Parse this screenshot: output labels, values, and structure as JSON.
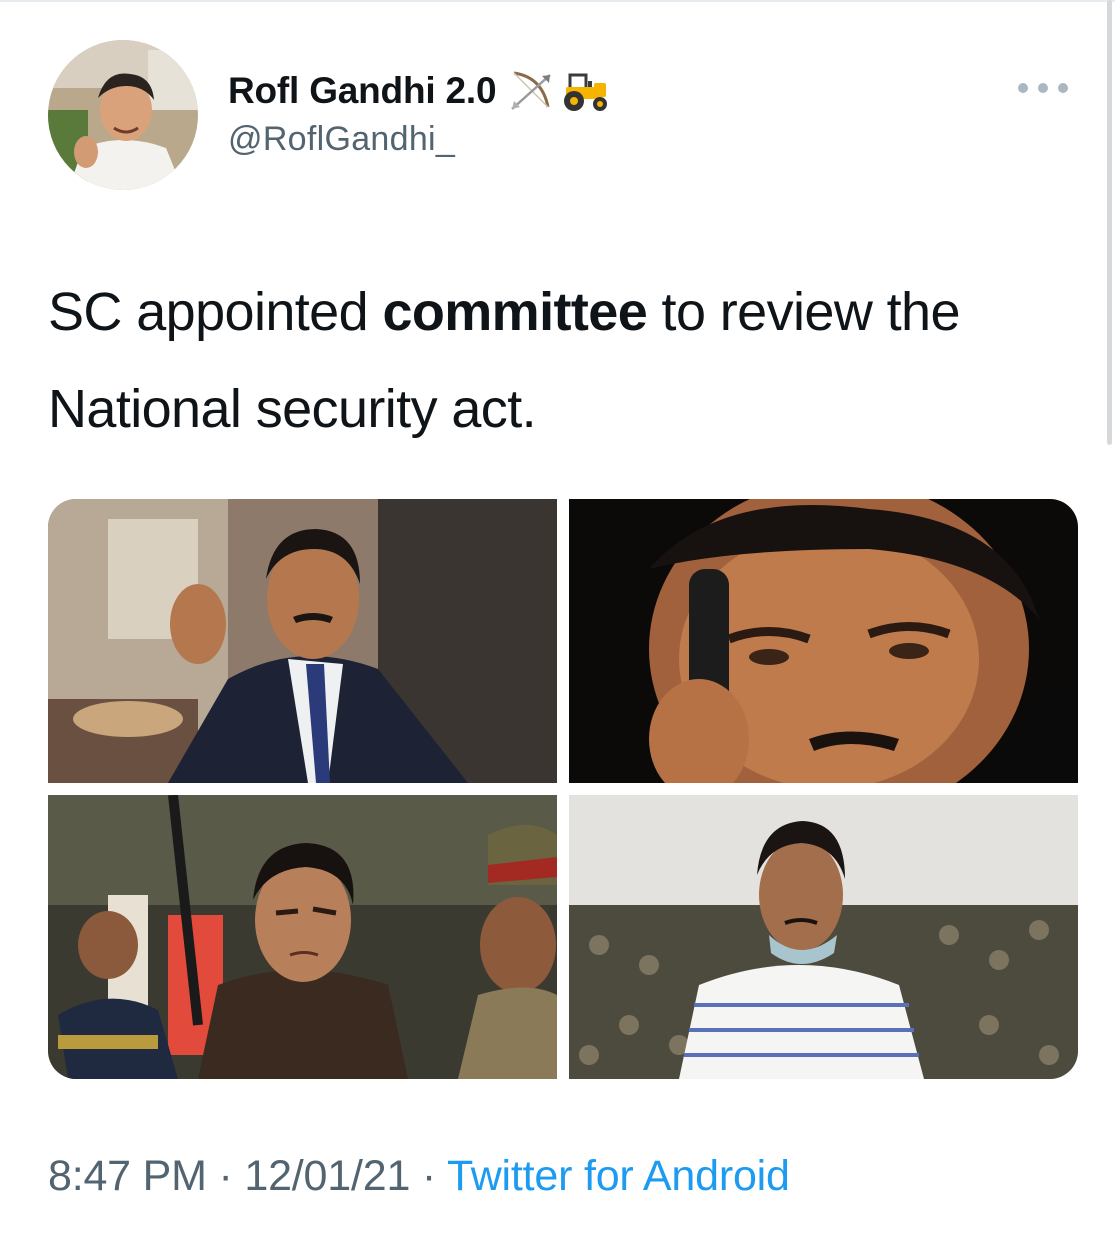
{
  "author": {
    "display_name": "Rofl Gandhi 2.0",
    "handle": "@RoflGandhi_",
    "badges": [
      "bow-and-arrow-icon",
      "tractor-icon"
    ]
  },
  "tweet": {
    "text_before": "SC appointed ",
    "text_bold": "committee",
    "text_after": " to review the National security act."
  },
  "media": {
    "count": 4,
    "photos": [
      "photo-man-in-suit-seated",
      "photo-man-on-phone-closeup",
      "photo-man-with-police",
      "photo-man-in-striped-shirt"
    ]
  },
  "meta": {
    "time": "8:47 PM",
    "separator": " · ",
    "date": "12/01/21",
    "source": "Twitter for Android"
  },
  "colors": {
    "text": "#0f1419",
    "secondary": "#536471",
    "link": "#1d9bf0"
  }
}
